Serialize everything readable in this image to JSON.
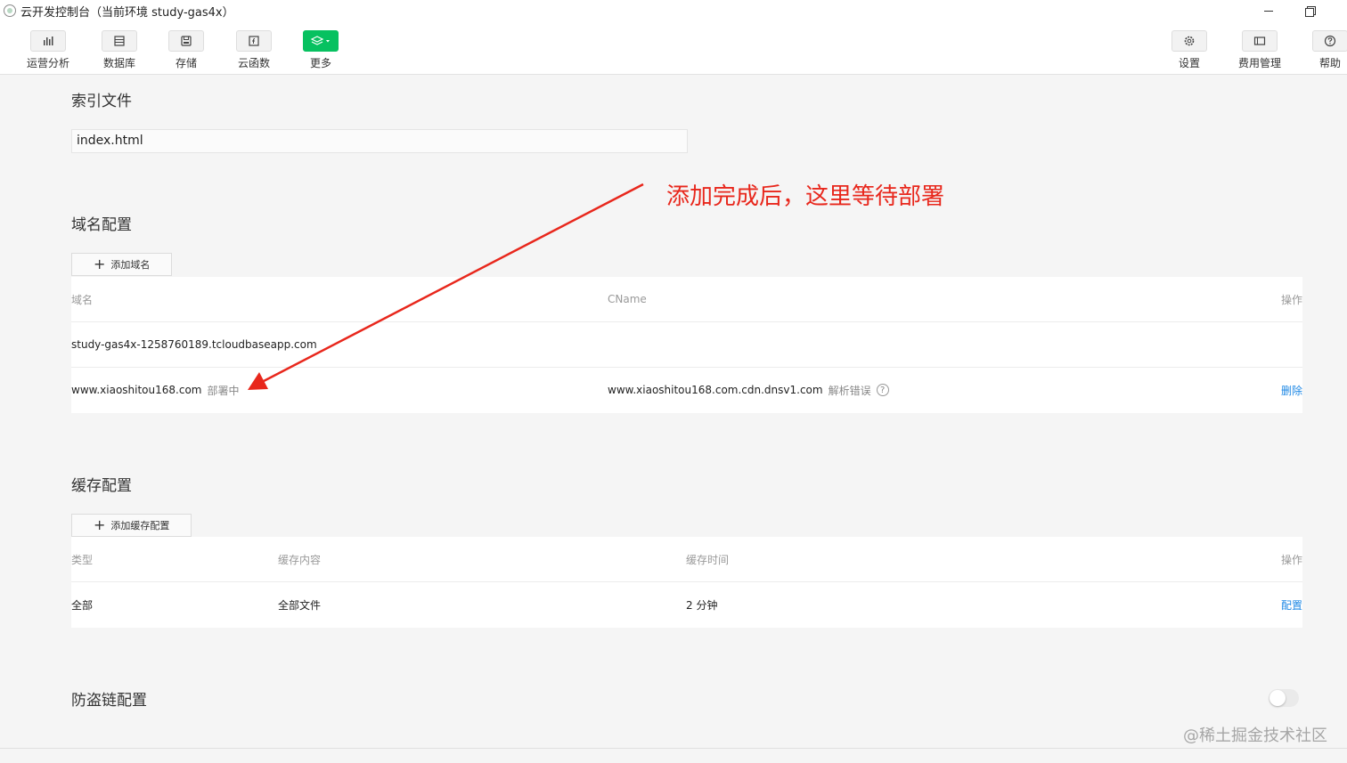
{
  "window": {
    "title": "云开发控制台（当前环境 study-gas4x）"
  },
  "toolbar": {
    "left": [
      {
        "label": "运营分析",
        "icon": "bar-chart-icon"
      },
      {
        "label": "数据库",
        "icon": "database-icon"
      },
      {
        "label": "存储",
        "icon": "storage-icon"
      },
      {
        "label": "云函数",
        "icon": "function-icon"
      },
      {
        "label": "更多",
        "icon": "layers-icon"
      }
    ],
    "right": [
      {
        "label": "设置",
        "icon": "gear-icon"
      },
      {
        "label": "费用管理",
        "icon": "wallet-icon"
      },
      {
        "label": "帮助",
        "icon": "help-icon"
      }
    ]
  },
  "index_section": {
    "title": "索引文件",
    "value": "index.html"
  },
  "domain_section": {
    "title": "域名配置",
    "add_label": "添加域名",
    "headers": {
      "domain": "域名",
      "cname": "CName",
      "action": "操作"
    },
    "rows": [
      {
        "domain": "study-gas4x-1258760189.tcloudbaseapp.com",
        "status": "",
        "cname": "",
        "cname_status": "",
        "action": ""
      },
      {
        "domain": "www.xiaoshitou168.com",
        "status": "部署中",
        "cname": "www.xiaoshitou168.com.cdn.dnsv1.com",
        "cname_status": "解析错误",
        "action": "删除"
      }
    ]
  },
  "cache_section": {
    "title": "缓存配置",
    "add_label": "添加缓存配置",
    "headers": {
      "type": "类型",
      "content": "缓存内容",
      "time": "缓存时间",
      "action": "操作"
    },
    "rows": [
      {
        "type": "全部",
        "content": "全部文件",
        "time": "2 分钟",
        "action": "配置"
      }
    ]
  },
  "hotlink_section": {
    "title": "防盗链配置",
    "enabled": false
  },
  "annotation": {
    "text": "添加完成后，这里等待部署",
    "color": "#e8271c"
  },
  "watermark": {
    "text": "@稀土掘金技术社区"
  },
  "colors": {
    "accent": "#07c160",
    "link": "#1e88e5"
  }
}
